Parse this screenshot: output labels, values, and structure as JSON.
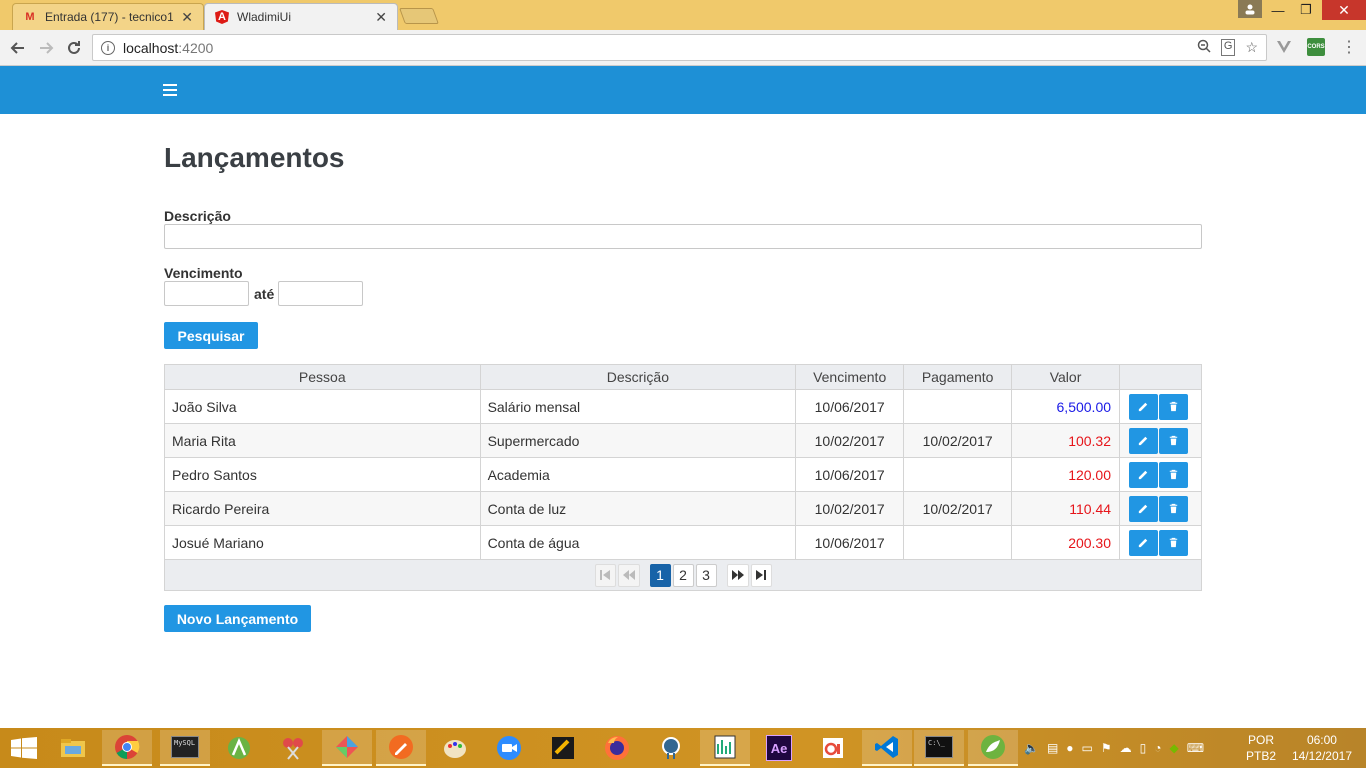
{
  "browser": {
    "tabs": [
      {
        "title": "Entrada (177) - tecnico10",
        "favicon": "gmail-icon"
      },
      {
        "title": "WladimiUi",
        "favicon": "angular-icon"
      }
    ],
    "url_host": "localhost",
    "url_port": ":4200"
  },
  "app": {
    "page_title": "Lançamentos",
    "filters": {
      "descricao_label": "Descrição",
      "descricao_value": "",
      "vencimento_label": "Vencimento",
      "vencimento_de": "",
      "ate_label": "até",
      "vencimento_ate": ""
    },
    "search_button": "Pesquisar",
    "table": {
      "headers": [
        "Pessoa",
        "Descrição",
        "Vencimento",
        "Pagamento",
        "Valor",
        ""
      ],
      "rows": [
        {
          "pessoa": "João Silva",
          "descricao": "Salário mensal",
          "vencimento": "10/06/2017",
          "pagamento": "",
          "valor": "6,500.00",
          "tipo": "RECEITA"
        },
        {
          "pessoa": "Maria Rita",
          "descricao": "Supermercado",
          "vencimento": "10/02/2017",
          "pagamento": "10/02/2017",
          "valor": "100.32",
          "tipo": "DESPESA"
        },
        {
          "pessoa": "Pedro Santos",
          "descricao": "Academia",
          "vencimento": "10/06/2017",
          "pagamento": "",
          "valor": "120.00",
          "tipo": "DESPESA"
        },
        {
          "pessoa": "Ricardo Pereira",
          "descricao": "Conta de luz",
          "vencimento": "10/02/2017",
          "pagamento": "10/02/2017",
          "valor": "110.44",
          "tipo": "DESPESA"
        },
        {
          "pessoa": "Josué Mariano",
          "descricao": "Conta de água",
          "vencimento": "10/06/2017",
          "pagamento": "",
          "valor": "200.30",
          "tipo": "DESPESA"
        }
      ]
    },
    "paginator": {
      "pages": [
        "1",
        "2",
        "3"
      ],
      "current": "1"
    },
    "new_button": "Novo Lançamento",
    "colors": {
      "primary": "#2196e3",
      "header": "#1e90d6",
      "receita": "#1a1ae6",
      "despesa": "#e6151a"
    }
  },
  "taskbar": {
    "apps": [
      "explorer-icon",
      "chrome-icon",
      "mysql-icon",
      "android-studio-icon",
      "snipping-icon",
      "app-icon",
      "pencil-app-icon",
      "paint-icon",
      "zoom-icon",
      "glary-icon",
      "firefox-icon",
      "postgres-icon",
      "notepad-icon",
      "after-effects-icon",
      "office-icon",
      "vscode-icon",
      "cmd-icon",
      "spring-icon"
    ],
    "lang_line1": "POR",
    "lang_line2": "PTB2",
    "time": "06:00",
    "date": "14/12/2017"
  }
}
